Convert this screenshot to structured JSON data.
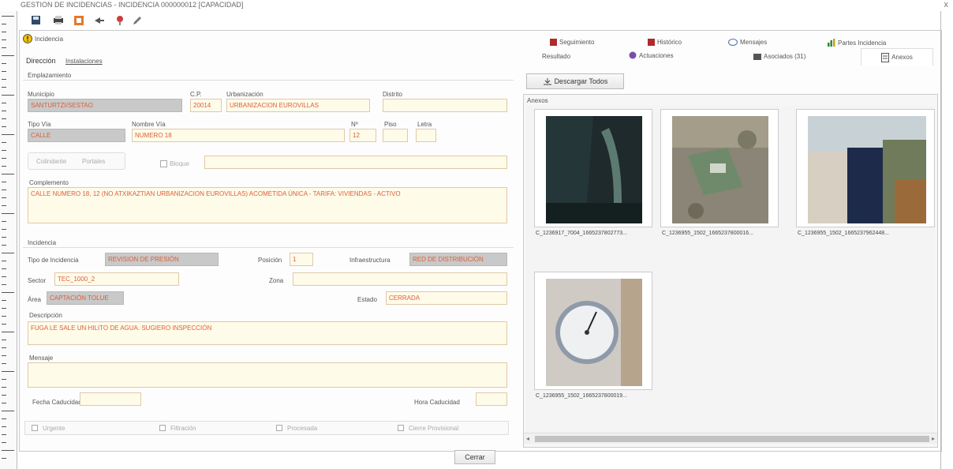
{
  "window": {
    "title": "GESTION DE INCIDENCIAS - INCIDENCIA 000000012 [CAPACIDAD]",
    "close": "x"
  },
  "toolbar": {
    "icons": [
      "save-icon",
      "print-icon",
      "orange-square-icon",
      "arrow-icon",
      "pin-icon",
      "pencil-icon"
    ]
  },
  "tab_incidencia": "Incidencia",
  "subtabs": {
    "direccion": "Dirección",
    "instalaciones": "Instalaciones"
  },
  "emplazamiento": {
    "header": "Emplazamiento",
    "municipio_label": "Municipio",
    "municipio": "SANTURTZI/SESTAO",
    "cp_label": "C.P.",
    "cp": "20014",
    "urbanizacion_label": "Urbanización",
    "urbanizacion": "URBANIZACION EUROVILLAS",
    "distrito_label": "Distrito",
    "distrito": "",
    "tipo_via_label": "Tipo Vía",
    "tipo_via": "CALLE",
    "nombre_via_label": "Nombre Vía",
    "nombre_via": "NUMERO 18",
    "n_label": "Nº",
    "n": "12",
    "piso_label": "Piso",
    "piso": "",
    "letra_label": "Letra",
    "letra": "",
    "toggles": [
      "Colindante",
      "Portales"
    ],
    "bloque_label": "Bloque",
    "bloque": "",
    "complemento_label": "Complemento",
    "complemento": "CALLE NUMERO 18, 12 (NO ATXIKAZTIAN URBANIZACION EUROVILLAS) ACOMETIDA ÚNICA - TARIFA: VIVIENDAS - ACTIVO"
  },
  "incidencia": {
    "header": "Incidencia",
    "tipo_label": "Tipo de Incidencia",
    "tipo": "REVISION DE PRESIÓN",
    "posicion_label": "Posición",
    "posicion": "1",
    "infra_label": "Infraestructura",
    "infra": "RED DE DISTRIBUCIÓN",
    "sector_label": "Sector",
    "sector": "TEC_1000_2",
    "zona_label": "Zona",
    "zona": "",
    "area_label": "Área",
    "area": "CAPTACIÓN TOLUE",
    "estado_label": "Estado",
    "estado": "CERRADA",
    "descripcion_label": "Descripción",
    "descripcion": "FUGA LE SALE UN HILITO DE AGUA. SUGIERO INSPECCIÓN",
    "mensaje_label": "Mensaje",
    "mensaje": "",
    "fecha_cad_label": "Fecha Caducidad",
    "fecha_cad": "",
    "hora_cad_label": "Hora Caducidad",
    "hora_cad": ""
  },
  "bottom_checks": [
    "Urgente",
    "Filtración",
    "Procesada",
    "Cierre Provisional"
  ],
  "cerrar": "Cerrar",
  "right_tabs": {
    "row1": [
      "Seguimiento",
      "Histórico",
      "Mensajes",
      "Partes Incidencia"
    ],
    "row2": [
      "Resultado",
      "Actuaciones",
      "Asociados (31)",
      "Anexos"
    ]
  },
  "descargar": "Descargar Todos",
  "anexos_label": "Anexos",
  "thumbnails": [
    {
      "caption": "C_1236917_7004_1665237802773...",
      "kind": "dark"
    },
    {
      "caption": "C_1236955_1502_1665237800016...",
      "kind": "ground"
    },
    {
      "caption": "C_1236955_1502_1665237962448...",
      "kind": "wall"
    },
    {
      "caption": "C_1236955_1502_1665237800019...",
      "kind": "gauge"
    }
  ],
  "colors": {
    "field_text": "#d9603b",
    "field_bg": "#fffbe9",
    "field_gray": "#c9c9c9"
  }
}
